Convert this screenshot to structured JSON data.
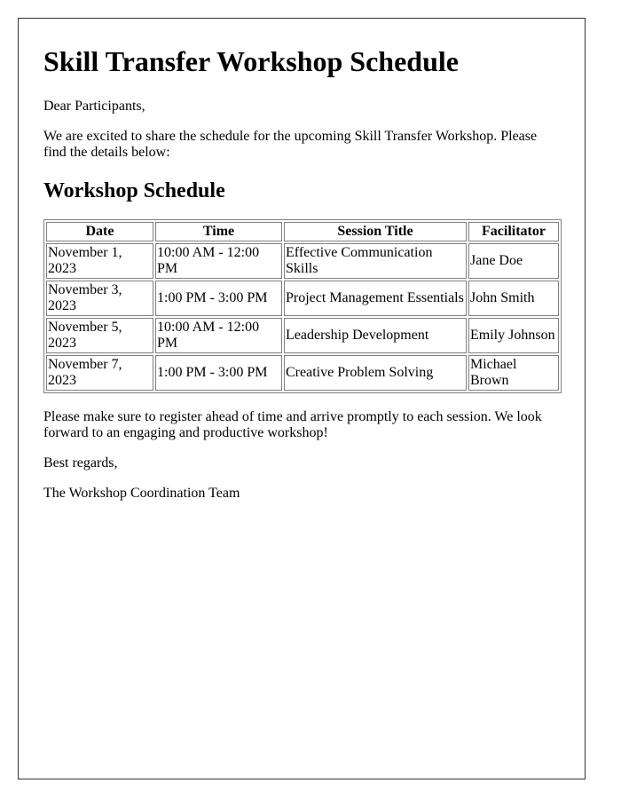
{
  "title": "Skill Transfer Workshop Schedule",
  "greeting": "Dear Participants,",
  "intro": "We are excited to share the schedule for the upcoming Skill Transfer Workshop. Please find the details below:",
  "section_title": "Workshop Schedule",
  "table": {
    "headers": [
      "Date",
      "Time",
      "Session Title",
      "Facilitator"
    ],
    "rows": [
      [
        "November 1, 2023",
        "10:00 AM - 12:00 PM",
        "Effective Communication Skills",
        "Jane Doe"
      ],
      [
        "November 3, 2023",
        "1:00 PM - 3:00 PM",
        "Project Management Essentials",
        "John Smith"
      ],
      [
        "November 5, 2023",
        "10:00 AM - 12:00 PM",
        "Leadership Development",
        "Emily Johnson"
      ],
      [
        "November 7, 2023",
        "1:00 PM - 3:00 PM",
        "Creative Problem Solving",
        "Michael Brown"
      ]
    ]
  },
  "closing": "Please make sure to register ahead of time and arrive promptly to each session. We look forward to an engaging and productive workshop!",
  "regards": "Best regards,",
  "signature": "The Workshop Coordination Team"
}
